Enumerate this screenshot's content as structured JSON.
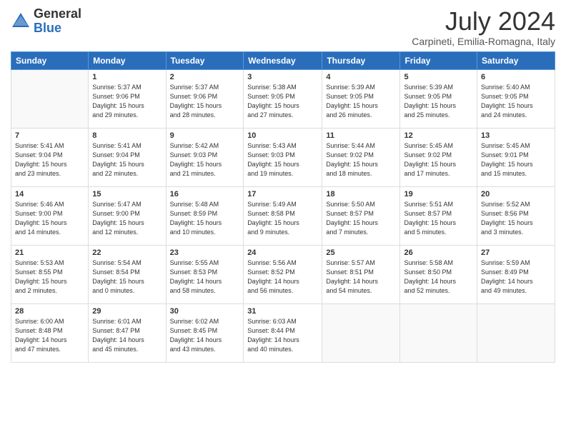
{
  "header": {
    "logo_general": "General",
    "logo_blue": "Blue",
    "month_year": "July 2024",
    "location": "Carpineti, Emilia-Romagna, Italy"
  },
  "columns": [
    "Sunday",
    "Monday",
    "Tuesday",
    "Wednesday",
    "Thursday",
    "Friday",
    "Saturday"
  ],
  "weeks": [
    [
      {
        "day": "",
        "detail": ""
      },
      {
        "day": "1",
        "detail": "Sunrise: 5:37 AM\nSunset: 9:06 PM\nDaylight: 15 hours\nand 29 minutes."
      },
      {
        "day": "2",
        "detail": "Sunrise: 5:37 AM\nSunset: 9:06 PM\nDaylight: 15 hours\nand 28 minutes."
      },
      {
        "day": "3",
        "detail": "Sunrise: 5:38 AM\nSunset: 9:05 PM\nDaylight: 15 hours\nand 27 minutes."
      },
      {
        "day": "4",
        "detail": "Sunrise: 5:39 AM\nSunset: 9:05 PM\nDaylight: 15 hours\nand 26 minutes."
      },
      {
        "day": "5",
        "detail": "Sunrise: 5:39 AM\nSunset: 9:05 PM\nDaylight: 15 hours\nand 25 minutes."
      },
      {
        "day": "6",
        "detail": "Sunrise: 5:40 AM\nSunset: 9:05 PM\nDaylight: 15 hours\nand 24 minutes."
      }
    ],
    [
      {
        "day": "7",
        "detail": "Sunrise: 5:41 AM\nSunset: 9:04 PM\nDaylight: 15 hours\nand 23 minutes."
      },
      {
        "day": "8",
        "detail": "Sunrise: 5:41 AM\nSunset: 9:04 PM\nDaylight: 15 hours\nand 22 minutes."
      },
      {
        "day": "9",
        "detail": "Sunrise: 5:42 AM\nSunset: 9:03 PM\nDaylight: 15 hours\nand 21 minutes."
      },
      {
        "day": "10",
        "detail": "Sunrise: 5:43 AM\nSunset: 9:03 PM\nDaylight: 15 hours\nand 19 minutes."
      },
      {
        "day": "11",
        "detail": "Sunrise: 5:44 AM\nSunset: 9:02 PM\nDaylight: 15 hours\nand 18 minutes."
      },
      {
        "day": "12",
        "detail": "Sunrise: 5:45 AM\nSunset: 9:02 PM\nDaylight: 15 hours\nand 17 minutes."
      },
      {
        "day": "13",
        "detail": "Sunrise: 5:45 AM\nSunset: 9:01 PM\nDaylight: 15 hours\nand 15 minutes."
      }
    ],
    [
      {
        "day": "14",
        "detail": "Sunrise: 5:46 AM\nSunset: 9:00 PM\nDaylight: 15 hours\nand 14 minutes."
      },
      {
        "day": "15",
        "detail": "Sunrise: 5:47 AM\nSunset: 9:00 PM\nDaylight: 15 hours\nand 12 minutes."
      },
      {
        "day": "16",
        "detail": "Sunrise: 5:48 AM\nSunset: 8:59 PM\nDaylight: 15 hours\nand 10 minutes."
      },
      {
        "day": "17",
        "detail": "Sunrise: 5:49 AM\nSunset: 8:58 PM\nDaylight: 15 hours\nand 9 minutes."
      },
      {
        "day": "18",
        "detail": "Sunrise: 5:50 AM\nSunset: 8:57 PM\nDaylight: 15 hours\nand 7 minutes."
      },
      {
        "day": "19",
        "detail": "Sunrise: 5:51 AM\nSunset: 8:57 PM\nDaylight: 15 hours\nand 5 minutes."
      },
      {
        "day": "20",
        "detail": "Sunrise: 5:52 AM\nSunset: 8:56 PM\nDaylight: 15 hours\nand 3 minutes."
      }
    ],
    [
      {
        "day": "21",
        "detail": "Sunrise: 5:53 AM\nSunset: 8:55 PM\nDaylight: 15 hours\nand 2 minutes."
      },
      {
        "day": "22",
        "detail": "Sunrise: 5:54 AM\nSunset: 8:54 PM\nDaylight: 15 hours\nand 0 minutes."
      },
      {
        "day": "23",
        "detail": "Sunrise: 5:55 AM\nSunset: 8:53 PM\nDaylight: 14 hours\nand 58 minutes."
      },
      {
        "day": "24",
        "detail": "Sunrise: 5:56 AM\nSunset: 8:52 PM\nDaylight: 14 hours\nand 56 minutes."
      },
      {
        "day": "25",
        "detail": "Sunrise: 5:57 AM\nSunset: 8:51 PM\nDaylight: 14 hours\nand 54 minutes."
      },
      {
        "day": "26",
        "detail": "Sunrise: 5:58 AM\nSunset: 8:50 PM\nDaylight: 14 hours\nand 52 minutes."
      },
      {
        "day": "27",
        "detail": "Sunrise: 5:59 AM\nSunset: 8:49 PM\nDaylight: 14 hours\nand 49 minutes."
      }
    ],
    [
      {
        "day": "28",
        "detail": "Sunrise: 6:00 AM\nSunset: 8:48 PM\nDaylight: 14 hours\nand 47 minutes."
      },
      {
        "day": "29",
        "detail": "Sunrise: 6:01 AM\nSunset: 8:47 PM\nDaylight: 14 hours\nand 45 minutes."
      },
      {
        "day": "30",
        "detail": "Sunrise: 6:02 AM\nSunset: 8:45 PM\nDaylight: 14 hours\nand 43 minutes."
      },
      {
        "day": "31",
        "detail": "Sunrise: 6:03 AM\nSunset: 8:44 PM\nDaylight: 14 hours\nand 40 minutes."
      },
      {
        "day": "",
        "detail": ""
      },
      {
        "day": "",
        "detail": ""
      },
      {
        "day": "",
        "detail": ""
      }
    ]
  ]
}
